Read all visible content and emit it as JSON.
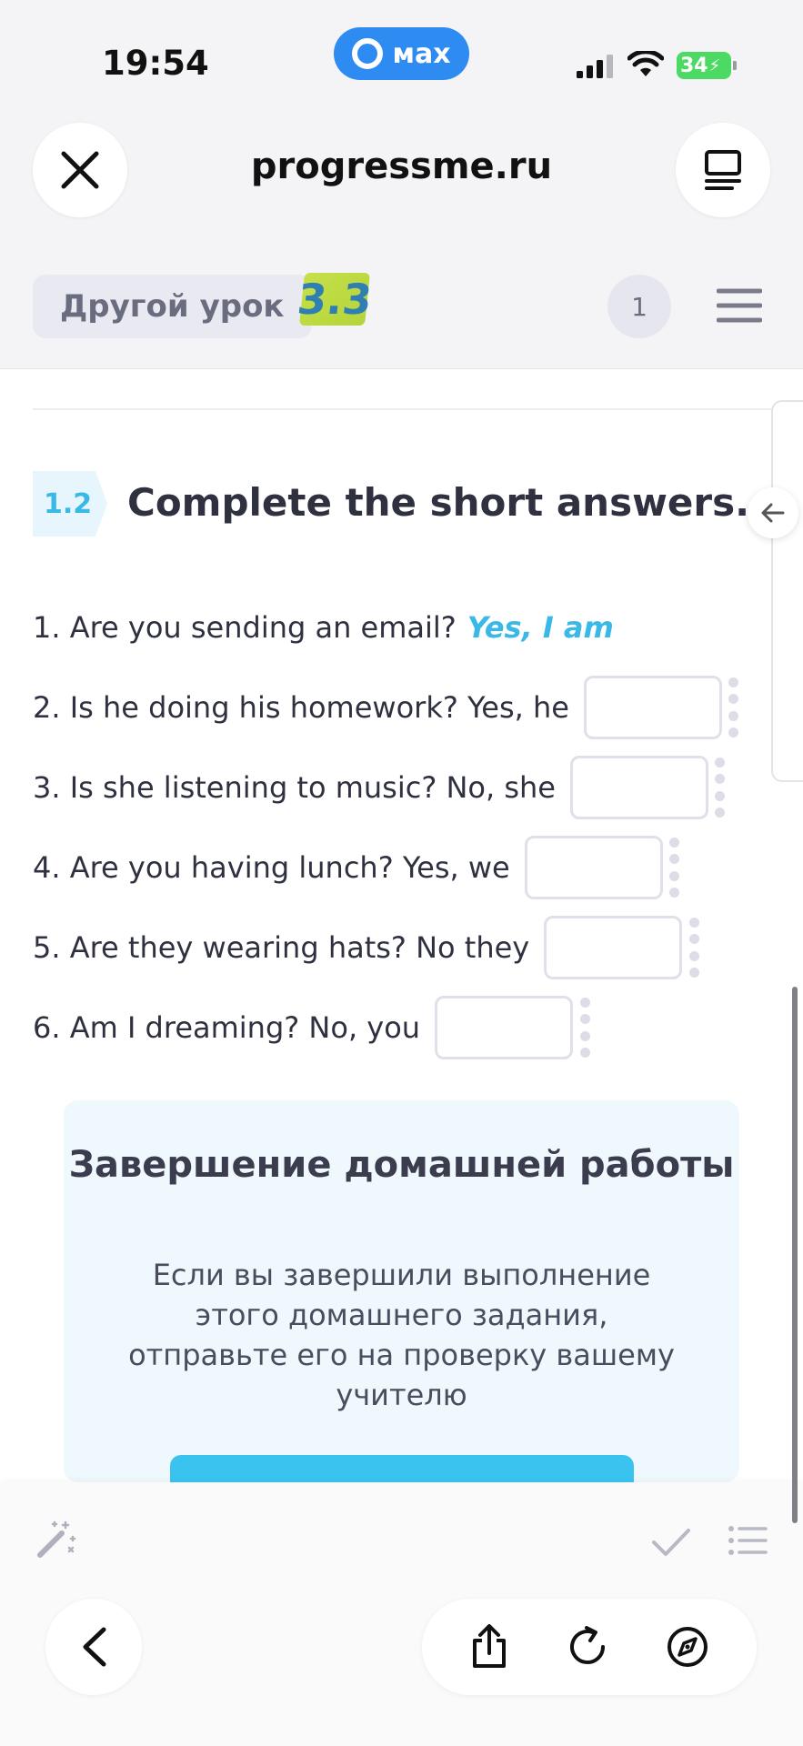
{
  "status_bar": {
    "time": "19:54",
    "max_label": "мах",
    "battery": "34"
  },
  "browser": {
    "url": "progressme.ru"
  },
  "toolbar": {
    "other_lesson": "Другой урок",
    "lesson_badge": "3.3",
    "page_number": "1"
  },
  "exercise": {
    "number": "1.2",
    "title": "Complete the short answers.",
    "questions": [
      {
        "text": "1. Are you sending an email?",
        "answer": "Yes, I am"
      },
      {
        "text": "2. Is he doing his homework? Yes, he",
        "input_value": ""
      },
      {
        "text": "3. Is she listening to music?  No, she",
        "input_value": ""
      },
      {
        "text": "4. Are you having lunch? Yes, we",
        "input_value": ""
      },
      {
        "text": "5. Are they wearing hats? No they",
        "input_value": ""
      },
      {
        "text": "6. Am I dreaming? No, you",
        "input_value": ""
      }
    ]
  },
  "completion_card": {
    "title": "Завершение домашней работы",
    "text": "Если вы завершили выполнение этого домашнего задания, отправьте его на проверку вашему учителю"
  },
  "colors": {
    "accent": "#3ab8e6",
    "button": "#3bc3f0",
    "card_bg": "#eef8fd",
    "badge_green": "#c6e04a"
  },
  "icons": {
    "close": "close-icon",
    "tabs": "tabs-icon",
    "menu": "hamburger-menu-icon",
    "side_arrow": "arrow-left-icon",
    "magic": "magic-wand-icon",
    "check": "check-icon",
    "list": "list-icon",
    "back": "chevron-left-icon",
    "share": "share-icon",
    "reload": "reload-icon",
    "compass": "compass-icon"
  }
}
